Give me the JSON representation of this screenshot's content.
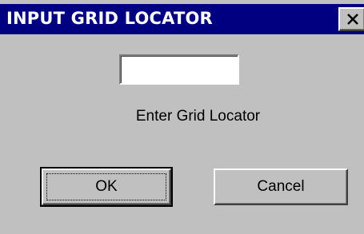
{
  "window": {
    "title": "INPUT GRID LOCATOR",
    "close_icon": "close-icon"
  },
  "form": {
    "locator_value": "",
    "locator_placeholder": "",
    "prompt": "Enter Grid Locator"
  },
  "buttons": {
    "ok_label": "OK",
    "cancel_label": "Cancel"
  },
  "colors": {
    "titlebar": "#000080",
    "face": "#c0c0c0"
  }
}
